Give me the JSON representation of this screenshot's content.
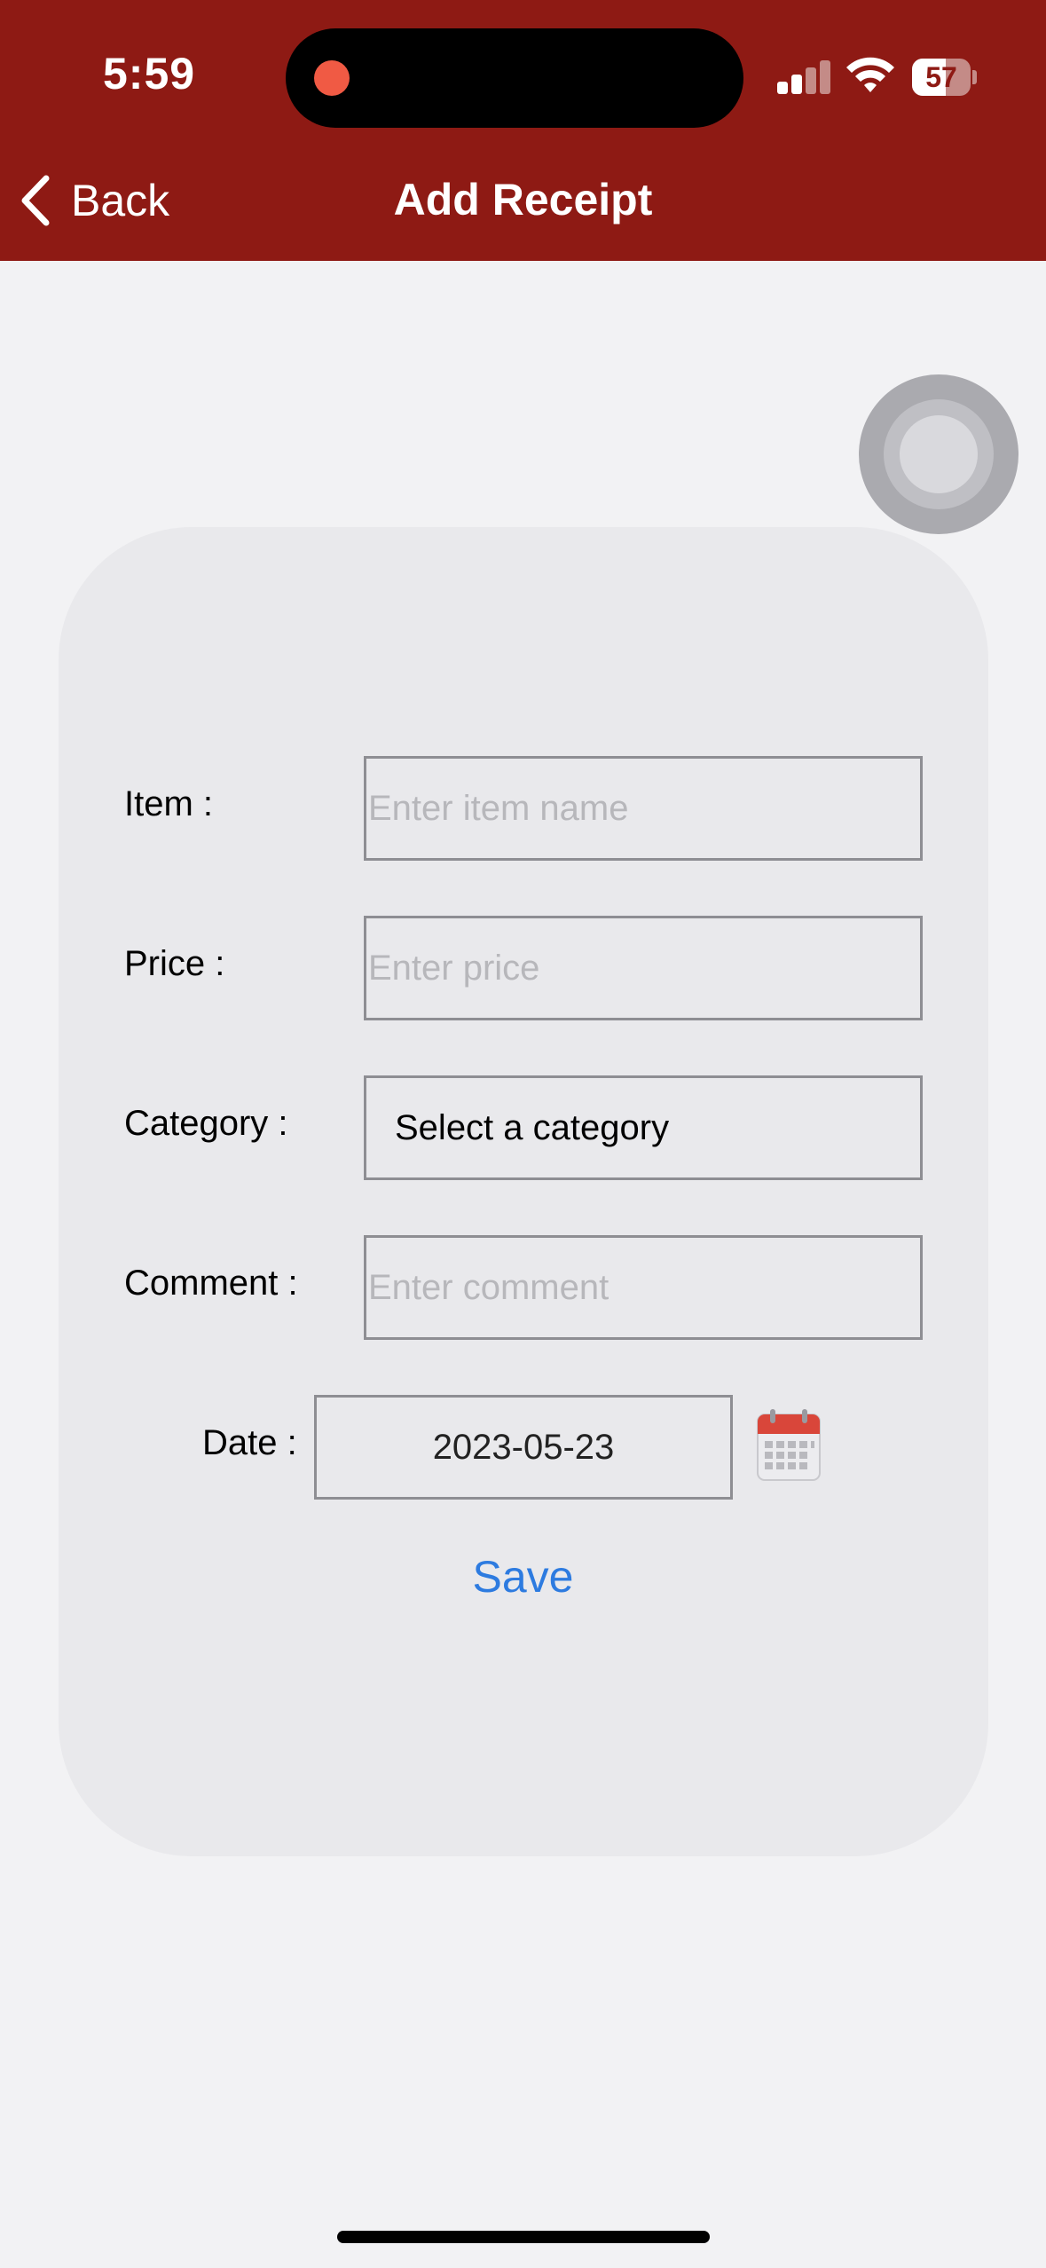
{
  "status_bar": {
    "time": "5:59",
    "battery": "57",
    "battery_level": 0.57,
    "recording_dot_color": "#f05a44"
  },
  "nav": {
    "back_label": "Back",
    "title": "Add Receipt",
    "bar_color": "#8e1a14"
  },
  "form": {
    "item_label": "Item :",
    "item_placeholder": "Enter item name",
    "price_label": "Price :",
    "price_placeholder": "Enter price",
    "category_label": "Category :",
    "category_value": "Select a category",
    "comment_label": "Comment :",
    "comment_placeholder": "Enter comment",
    "date_label": "Date :",
    "date_value": "2023-05-23",
    "save_label": "Save",
    "accent_color": "#2d7be0"
  }
}
